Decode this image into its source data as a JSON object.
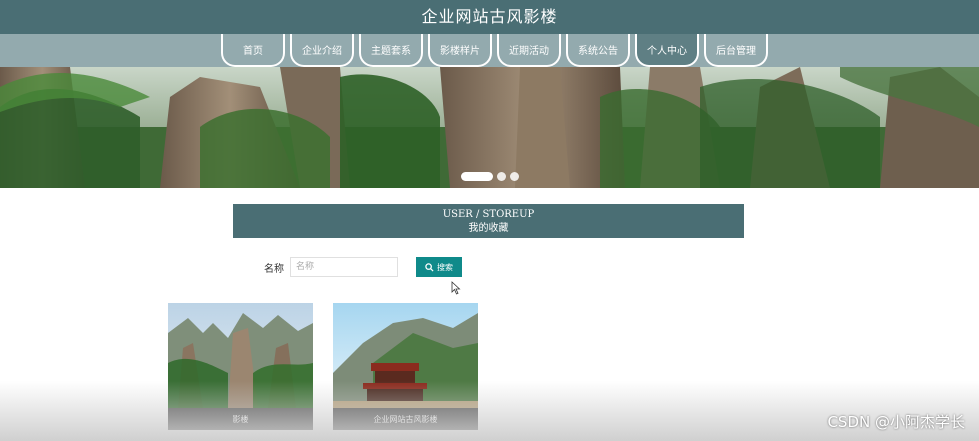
{
  "site": {
    "title": "企业网站古风影楼"
  },
  "nav": {
    "items": [
      {
        "label": "首页"
      },
      {
        "label": "企业介绍"
      },
      {
        "label": "主题套系"
      },
      {
        "label": "影楼样片"
      },
      {
        "label": "近期活动"
      },
      {
        "label": "系统公告"
      },
      {
        "label": "个人中心"
      },
      {
        "label": "后台管理"
      }
    ],
    "active_label": "个人中心"
  },
  "banner": {
    "slide_count": 3,
    "active_slide": 1
  },
  "section": {
    "en_title": "USER / STOREUP",
    "zh_title": "我的收藏"
  },
  "search": {
    "label": "名称",
    "placeholder": "名称",
    "value": "",
    "button_label": "搜索"
  },
  "favorites": [
    {
      "name": "影楼"
    },
    {
      "name": "企业网站古风影楼"
    }
  ],
  "watermark": "CSDN @小阿杰学长",
  "colors": {
    "header": "#4a6e74",
    "nav": "#93aaae",
    "search_button": "#0f8a8a",
    "caption": "#555555"
  }
}
